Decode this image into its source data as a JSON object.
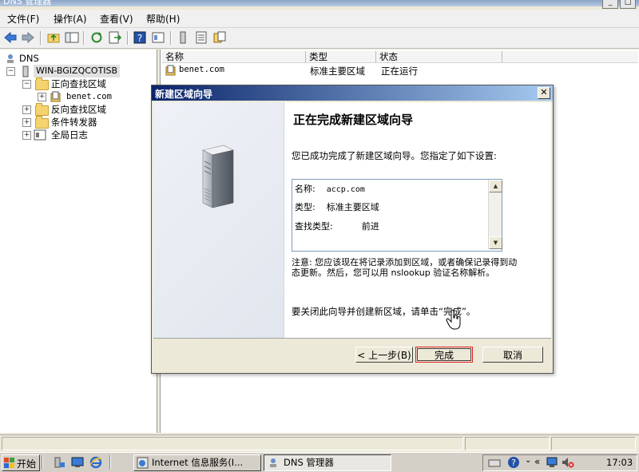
{
  "window": {
    "title": "DNS 管理器",
    "controls": [
      "_",
      "□"
    ]
  },
  "menu": [
    "文件(F)",
    "操作(A)",
    "查看(V)",
    "帮助(H)"
  ],
  "tree": {
    "root": "DNS",
    "server": "WIN-BGIZQCOTISB",
    "forward": "正向查找区域",
    "zone": "benet.com",
    "reverse": "反向查找区域",
    "conditional": "条件转发器",
    "logs": "全局日志"
  },
  "list": {
    "columns": [
      "名称",
      "类型",
      "状态"
    ],
    "rows": [
      {
        "name": "benet.com",
        "type": "标准主要区域",
        "status": "正在运行"
      }
    ]
  },
  "wizard": {
    "title": "新建区域向导",
    "close": "✕",
    "heading": "正在完成新建区域向导",
    "intro": "您已成功完成了新建区域向导。您指定了如下设置:",
    "settings": [
      {
        "label": "名称:",
        "value": "accp.com"
      },
      {
        "label": "类型:",
        "value": "标准主要区域"
      },
      {
        "label": "查找类型:",
        "value": "前进"
      }
    ],
    "note": "注意: 您应该现在将记录添加到区域，或者确保记录得到动态更新。然后，您可以用 nslookup 验证名称解析。",
    "closing": "要关闭此向导并创建新区域，请单击“完成”。",
    "buttons": {
      "back": "< 上一步(B)",
      "finish": "完成",
      "cancel": "取消"
    }
  },
  "taskbar": {
    "start": "开始",
    "tasks": [
      "Internet 信息服务(I...",
      "DNS 管理器"
    ],
    "time": "17:03"
  },
  "colors": {
    "dialogTitle": "#0a246a",
    "finishHighlight": "#e02020"
  }
}
